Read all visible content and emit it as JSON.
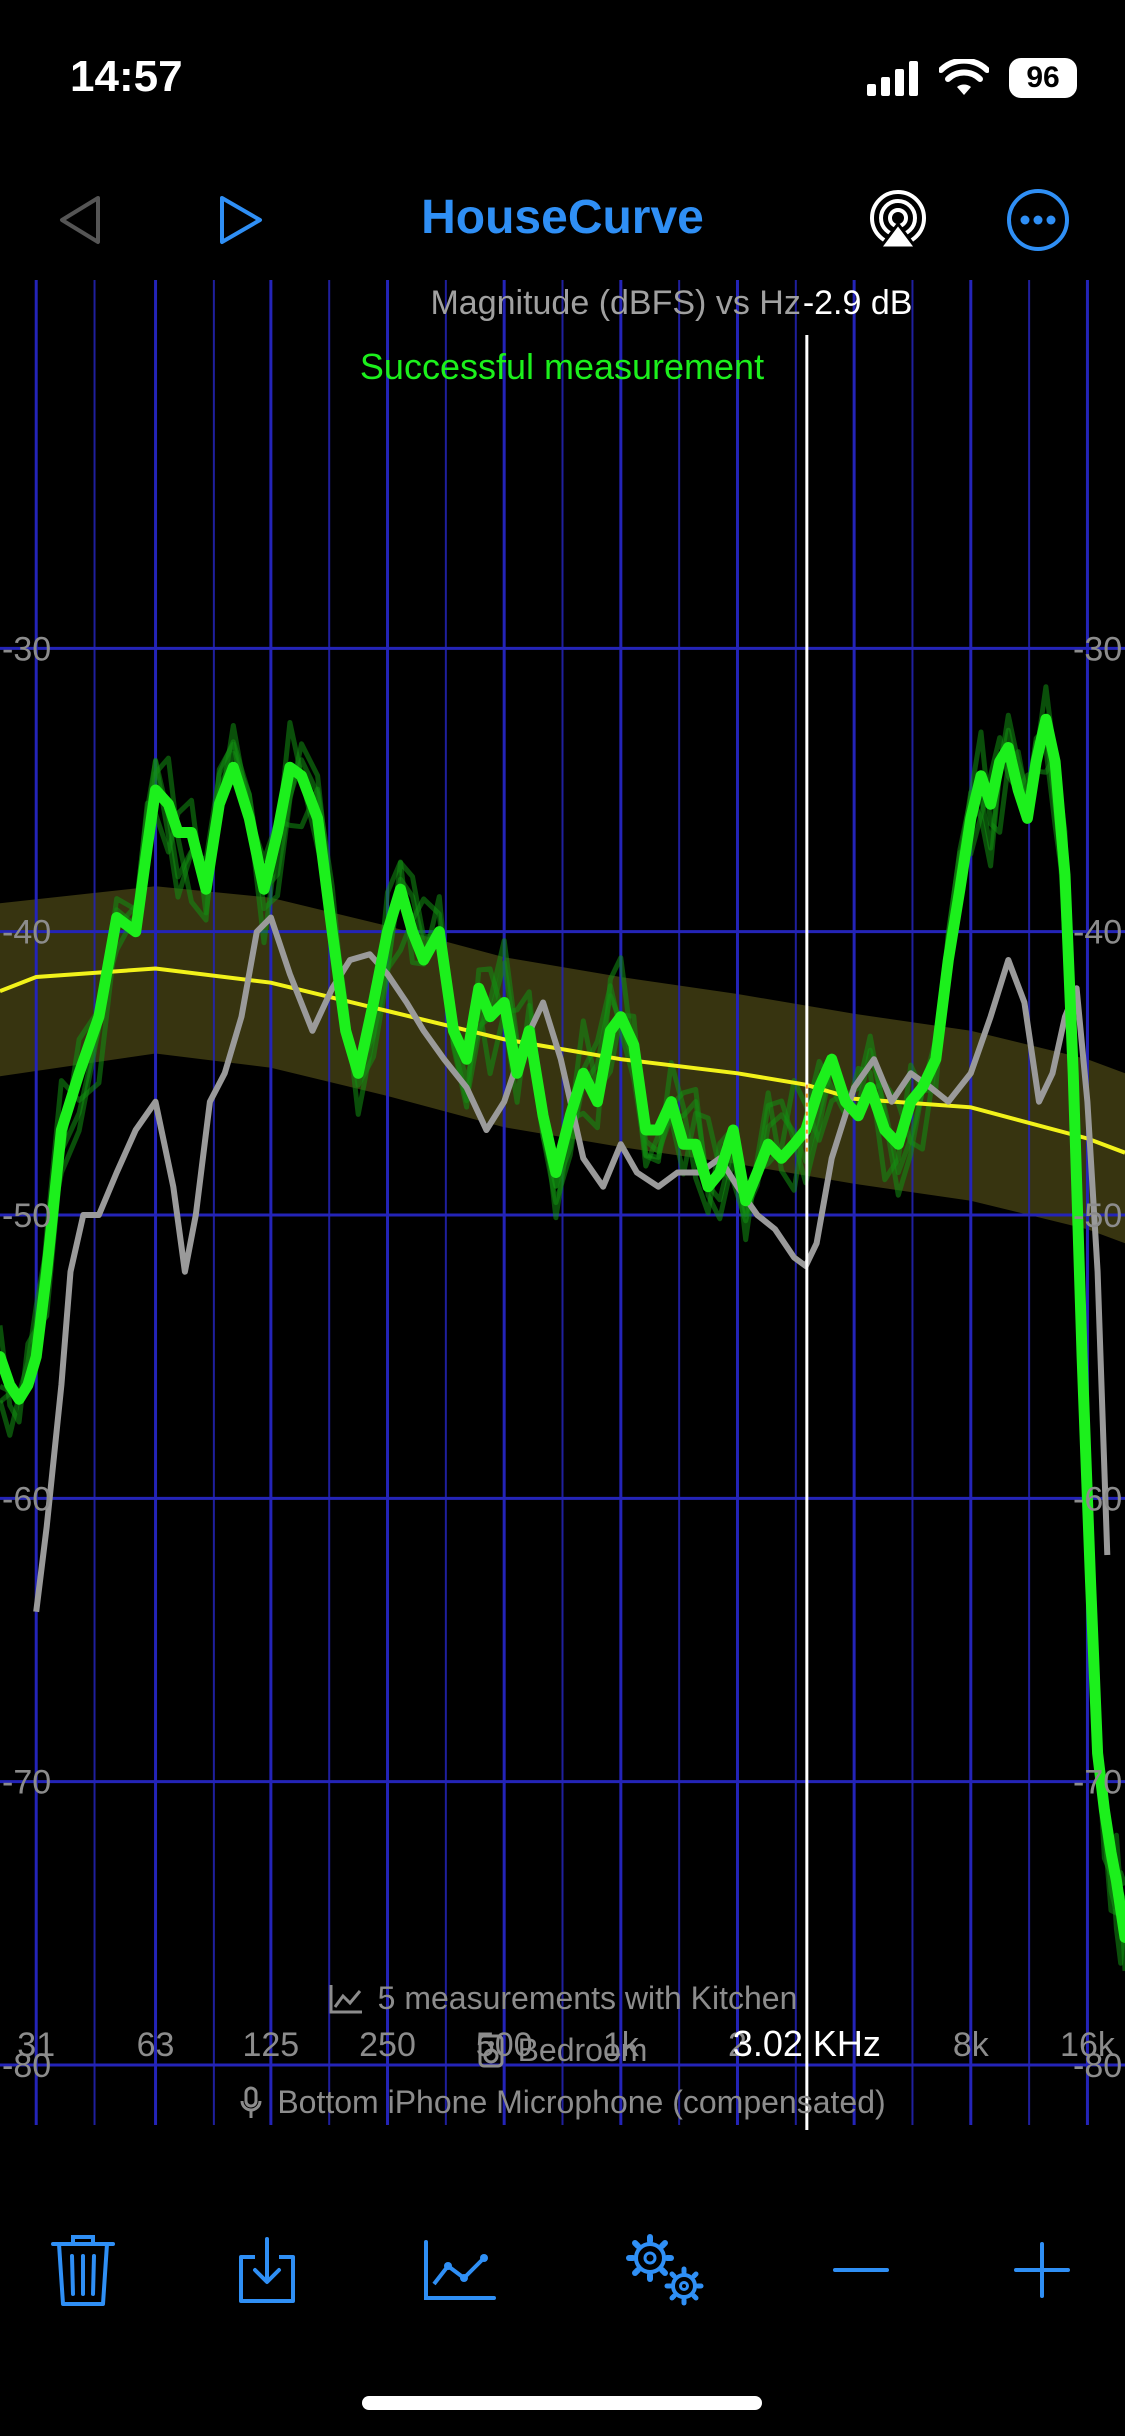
{
  "status": {
    "time": "14:57",
    "battery": "96"
  },
  "nav": {
    "title": "HouseCurve",
    "back_icon": "back-triangle-icon",
    "play_icon": "play-icon",
    "airplay_icon": "airplay-icon",
    "more_icon": "ellipsis-circle-icon"
  },
  "colors": {
    "accent": "#2f8ff5",
    "grid": "#2424b8",
    "measurement": "#1cf01c",
    "reference": "#9a9a9a",
    "target": "#f2f21a",
    "target_band": "#3d3a12"
  },
  "chart_data": {
    "type": "line",
    "title": "Magnitude (dBFS) vs Hz",
    "status_message": "Successful measurement",
    "cursor": {
      "value_label": "-2.9 dB",
      "freq_label": "3.02 KHz",
      "freq": 3020
    },
    "x_scale": "log",
    "xlim": [
      25,
      20000
    ],
    "ylim": [
      -83,
      -17
    ],
    "x_ticks": [
      31,
      63,
      125,
      250,
      500,
      1000,
      2000,
      4000,
      8000,
      16000
    ],
    "x_tick_labels": [
      "31",
      "63",
      "125",
      "250",
      "500",
      "1k",
      "2",
      "",
      "8k",
      "16k"
    ],
    "y_ticks": [
      -30,
      -40,
      -50,
      -60,
      -70,
      -80
    ],
    "y_tick_labels": [
      "-30",
      "-40",
      "-50",
      "-60",
      "-70",
      "-80"
    ],
    "grid": true,
    "series": [
      {
        "role": "target-curve",
        "x": [
          25,
          31,
          63,
          125,
          250,
          500,
          1000,
          2000,
          3000,
          4000,
          8000,
          16000,
          20000
        ],
        "y": [
          -42.1,
          -41.6,
          -41.3,
          -41.8,
          -42.8,
          -43.8,
          -44.5,
          -45.0,
          -45.4,
          -45.9,
          -46.2,
          -47.3,
          -47.8
        ]
      },
      {
        "role": "target-band-upper",
        "x": [
          25,
          63,
          125,
          250,
          500,
          1000,
          2000,
          4000,
          8000,
          16000,
          20000
        ],
        "y": [
          -39.0,
          -38.4,
          -38.8,
          -39.8,
          -40.9,
          -41.6,
          -42.2,
          -42.9,
          -43.5,
          -44.5,
          -45.0
        ]
      },
      {
        "role": "target-band-lower",
        "x": [
          25,
          63,
          125,
          250,
          500,
          1000,
          2000,
          4000,
          8000,
          16000,
          20000
        ],
        "y": [
          -45.1,
          -44.3,
          -44.8,
          -45.8,
          -46.9,
          -47.6,
          -48.2,
          -48.9,
          -49.5,
          -50.5,
          -51.0
        ]
      },
      {
        "role": "reference-measurement",
        "x": [
          31,
          33,
          36,
          38,
          41,
          45,
          50,
          56,
          63,
          70,
          75,
          80,
          87,
          95,
          105,
          115,
          125,
          140,
          160,
          180,
          200,
          225,
          250,
          280,
          310,
          350,
          400,
          450,
          500,
          560,
          630,
          700,
          800,
          900,
          1000,
          1100,
          1250,
          1400,
          1600,
          1800,
          2000,
          2250,
          2500,
          2800,
          3000,
          3200,
          3500,
          4000,
          4500,
          5000,
          5600,
          6300,
          7000,
          8000,
          9000,
          10000,
          11000,
          12000,
          13000,
          14000,
          15000,
          16000,
          17000,
          18000
        ],
        "y": [
          -64.0,
          -61.0,
          -56.0,
          -52.0,
          -50.0,
          -50.0,
          -48.5,
          -47.0,
          -46.0,
          -49.0,
          -52.0,
          -50.0,
          -46.0,
          -45.0,
          -43.0,
          -40.0,
          -39.5,
          -41.5,
          -43.5,
          -42.0,
          -41.0,
          -40.8,
          -41.5,
          -42.5,
          -43.5,
          -44.5,
          -45.5,
          -47.0,
          -46.0,
          -44.0,
          -42.5,
          -44.5,
          -48.0,
          -49.0,
          -47.5,
          -48.5,
          -49.0,
          -48.5,
          -48.5,
          -48.0,
          -49.0,
          -50.0,
          -50.5,
          -51.5,
          -51.8,
          -51.0,
          -48.0,
          -45.5,
          -44.5,
          -46.0,
          -45.0,
          -45.5,
          -46.0,
          -45.0,
          -43.0,
          -41.0,
          -42.5,
          -46.0,
          -45.0,
          -43.0,
          -42.0,
          -46.0,
          -52.0,
          -62.0
        ]
      },
      {
        "role": "average-measurement",
        "x": [
          25,
          26.5,
          28,
          29.5,
          31,
          33,
          36,
          40,
          45,
          50,
          56,
          60,
          63,
          68,
          72,
          78,
          85,
          92,
          100,
          110,
          120,
          130,
          140,
          150,
          165,
          180,
          195,
          210,
          230,
          250,
          270,
          290,
          310,
          340,
          370,
          400,
          430,
          460,
          500,
          540,
          580,
          630,
          680,
          740,
          800,
          870,
          940,
          1000,
          1080,
          1160,
          1250,
          1350,
          1450,
          1560,
          1680,
          1800,
          1950,
          2100,
          2250,
          2400,
          2600,
          2800,
          3000,
          3250,
          3500,
          3800,
          4100,
          4400,
          4800,
          5200,
          5600,
          6000,
          6500,
          7000,
          7500,
          8000,
          8500,
          9000,
          9500,
          10000,
          10600,
          11200,
          11800,
          12500,
          13200,
          14000,
          14700,
          15500,
          16300,
          17000,
          17700,
          18400,
          19000,
          19500,
          20000
        ],
        "y": [
          -55.0,
          -56.0,
          -56.5,
          -56.0,
          -55.0,
          -52.0,
          -47.0,
          -45.0,
          -43.0,
          -39.5,
          -40.0,
          -37.0,
          -35.0,
          -35.5,
          -36.5,
          -36.5,
          -38.5,
          -35.5,
          -34.2,
          -36.0,
          -38.5,
          -36.5,
          -34.2,
          -34.5,
          -36.0,
          -40.0,
          -43.5,
          -45.0,
          -42.5,
          -40.0,
          -38.5,
          -40.0,
          -41.0,
          -40.0,
          -43.5,
          -44.5,
          -42.0,
          -43.0,
          -42.5,
          -45.0,
          -43.5,
          -46.5,
          -48.5,
          -46.5,
          -45.0,
          -46.0,
          -43.5,
          -43.0,
          -44.0,
          -47.0,
          -47.0,
          -46.0,
          -47.5,
          -47.5,
          -49.0,
          -48.5,
          -47.0,
          -49.5,
          -48.5,
          -47.5,
          -48.0,
          -47.5,
          -47.0,
          -45.5,
          -44.5,
          -46.0,
          -46.5,
          -45.5,
          -47.0,
          -47.5,
          -46.0,
          -45.5,
          -44.5,
          -41.0,
          -38.5,
          -36.0,
          -34.5,
          -35.5,
          -34.0,
          -33.5,
          -35.0,
          -36.0,
          -34.0,
          -32.5,
          -34.0,
          -38.0,
          -45.0,
          -55.0,
          -63.0,
          -69.0,
          -71.0,
          -72.5,
          -73.5,
          -74.5,
          -75.5
        ]
      }
    ]
  },
  "info": {
    "measurements": "5 measurements with Kitchen",
    "room": "Bedroom",
    "microphone": "Bottom iPhone Microphone (compensated)"
  },
  "toolbar": {
    "trash_icon": "trash-icon",
    "export_icon": "download-icon",
    "chart_icon": "line-chart-icon",
    "settings_icon": "gears-icon",
    "zoom_out_icon": "minus-icon",
    "zoom_in_icon": "plus-icon"
  }
}
